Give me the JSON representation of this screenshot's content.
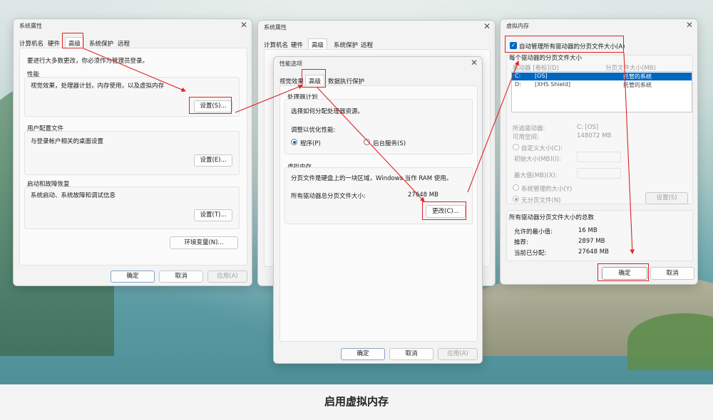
{
  "caption": "启用虚拟内存",
  "sys1": {
    "title": "系统属性",
    "tabs": [
      "计算机名",
      "硬件",
      "高级",
      "系统保护",
      "远程"
    ],
    "notice": "要进行大多数更改，你必须作为管理员登录。",
    "perf_title": "性能",
    "perf_desc": "视觉效果，处理器计划，内存使用，以及虚拟内存",
    "perf_btn": "设置(S)...",
    "profile_title": "用户配置文件",
    "profile_desc": "与登录帐户相关的桌面设置",
    "profile_btn": "设置(E)...",
    "startup_title": "启动和故障恢复",
    "startup_desc": "系统启动、系统故障和调试信息",
    "startup_btn": "设置(T)...",
    "env_btn": "环境变量(N)...",
    "ok": "确定",
    "cancel": "取消",
    "apply": "应用(A)"
  },
  "sys2": {
    "title": "系统属性",
    "tabs": [
      "计算机名",
      "硬件",
      "高级",
      "系统保护",
      "远程"
    ]
  },
  "perf": {
    "title": "性能选项",
    "tabs": [
      "视觉效果",
      "高级",
      "数据执行保护"
    ],
    "sched_title": "处理器计划",
    "sched_desc": "选择如何分配处理器资源。",
    "adjust": "调整以优化性能:",
    "opt_programs": "程序(P)",
    "opt_services": "后台服务(S)",
    "vm_title": "虚拟内存",
    "vm_desc": "分页文件是硬盘上的一块区域，Windows 当作 RAM 使用。",
    "vm_total_label": "所有驱动器总分页文件大小:",
    "vm_total_value": "27648 MB",
    "change_btn": "更改(C)...",
    "ok": "确定",
    "cancel": "取消",
    "apply": "应用(A)"
  },
  "vm": {
    "title": "虚拟内存",
    "auto_manage": "自动管理所有驱动器的分页文件大小(A)",
    "per_drive": "每个驱动器的分页文件大小",
    "col_drive": "驱动器 [卷标](D)",
    "col_size": "分页文件大小(MB)",
    "rows": [
      {
        "drive": "C:",
        "label": "[OS]",
        "size": "托管的系统"
      },
      {
        "drive": "D:",
        "label": "[XHS Shield]",
        "size": "托管的系统"
      }
    ],
    "sel_drive_label": "所选驱动器:",
    "sel_drive_value": "C: [OS]",
    "free_label": "可用空间:",
    "free_value": "148072 MB",
    "custom": "自定义大小(C):",
    "initial": "初始大小(MB)(I):",
    "max": "最大值(MB)(X):",
    "system_managed": "系统管理的大小(Y)",
    "no_paging": "无分页文件(N)",
    "set_btn": "设置(S)",
    "total_title": "所有驱动器分页文件大小的总数",
    "min_label": "允许的最小值:",
    "min_value": "16 MB",
    "rec_label": "推荐:",
    "rec_value": "2897 MB",
    "cur_label": "当前已分配:",
    "cur_value": "27648 MB",
    "ok": "确定",
    "cancel": "取消"
  },
  "colors": {
    "highlight": "#e02424",
    "accent": "#0067c0"
  }
}
